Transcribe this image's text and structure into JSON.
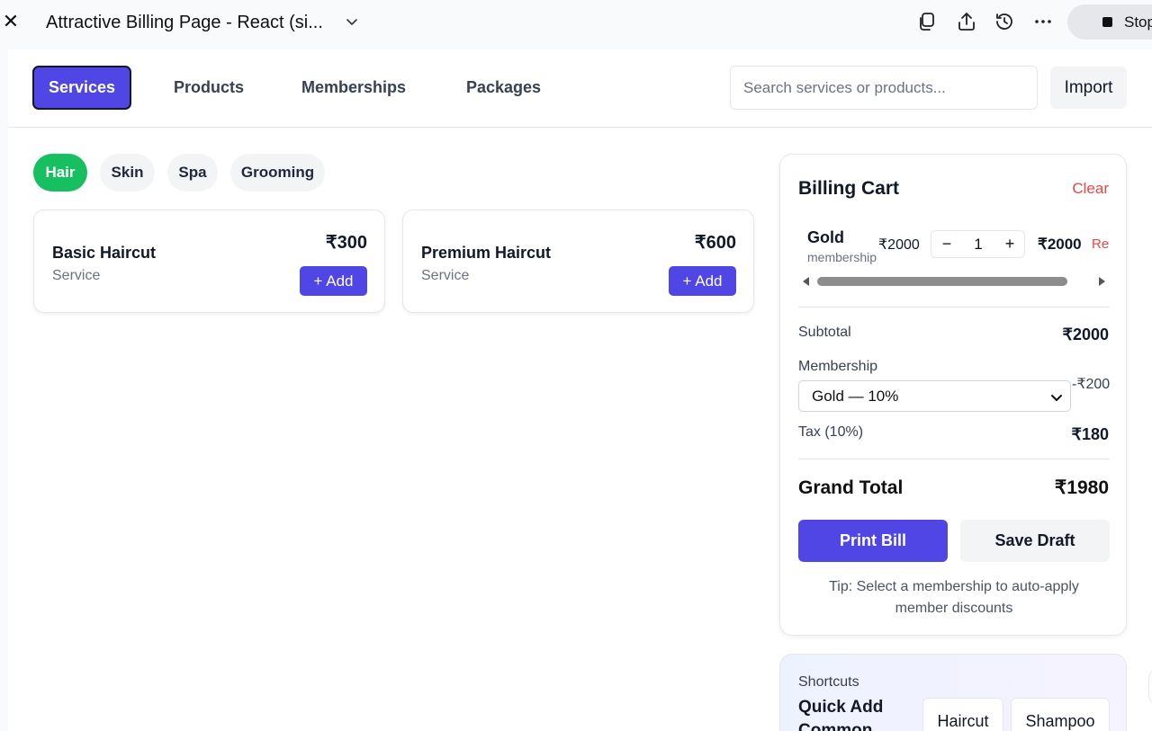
{
  "window": {
    "title": "Attractive Billing Page - React (si...",
    "stop_label": "Stop"
  },
  "nav": {
    "tabs": [
      {
        "label": "Services"
      },
      {
        "label": "Products"
      },
      {
        "label": "Memberships"
      },
      {
        "label": "Packages"
      }
    ],
    "search_placeholder": "Search services or products...",
    "import_label": "Import"
  },
  "filters": {
    "chips": [
      {
        "label": "Hair"
      },
      {
        "label": "Skin"
      },
      {
        "label": "Spa"
      },
      {
        "label": "Grooming"
      }
    ]
  },
  "catalog": {
    "items": [
      {
        "name": "Basic Haircut",
        "type": "Service",
        "price": "₹300",
        "add_label": "+ Add"
      },
      {
        "name": "Premium Haircut",
        "type": "Service",
        "price": "₹600",
        "add_label": "+ Add"
      }
    ]
  },
  "cart": {
    "title": "Billing Cart",
    "clear_label": "Clear",
    "items": [
      {
        "name": "Gold",
        "category": "membership",
        "unit_price": "₹2000",
        "qty_minus": "−",
        "qty": "1",
        "qty_plus": "+",
        "line_total": "₹2000",
        "remove_label": "Remove"
      }
    ],
    "subtotal_label": "Subtotal",
    "subtotal_value": "₹2000",
    "membership_label": "Membership",
    "membership_selected": "Gold — 10%",
    "membership_discount": "-₹200",
    "tax_label": "Tax (10%)",
    "tax_value": "₹180",
    "grand_total_label": "Grand Total",
    "grand_total_value": "₹1980",
    "print_label": "Print Bill",
    "draft_label": "Save Draft",
    "tip": "Tip: Select a membership to auto-apply member discounts"
  },
  "shortcuts": {
    "label": "Shortcuts",
    "title": "Quick Add Common",
    "buttons": [
      {
        "label": "Haircut"
      },
      {
        "label": "Shampoo"
      }
    ]
  },
  "colors": {
    "accent": "#4f46e5",
    "chip_active": "#16c060",
    "danger": "#ef4444"
  }
}
